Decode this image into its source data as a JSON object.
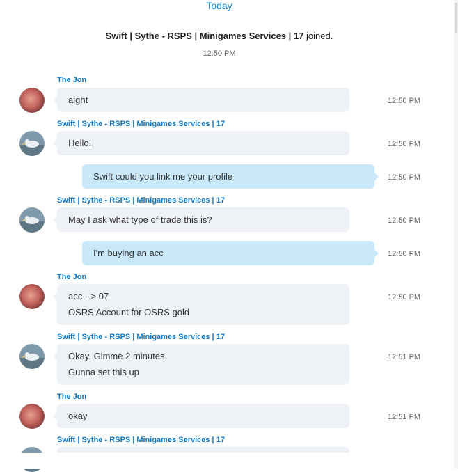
{
  "conversation": {
    "day_label": "Today",
    "join_event": {
      "name": "Swift | Sythe - RSPS | Minigames Services | 17",
      "action": "joined.",
      "time": "12:50 PM"
    },
    "messages": [
      {
        "sender": "The Jon",
        "avatar": "avatar-red-icon",
        "direction": "in",
        "lines": [
          "aight"
        ],
        "time": "12:50 PM"
      },
      {
        "sender": "Swift | Sythe - RSPS | Minigames Services | 17",
        "avatar": "avatar-pelican-icon",
        "direction": "in",
        "lines": [
          "Hello!"
        ],
        "time": "12:50 PM"
      },
      {
        "sender": "",
        "direction": "out",
        "lines": [
          "Swift could you link me your profile"
        ],
        "time": "12:50 PM"
      },
      {
        "sender": "Swift | Sythe - RSPS | Minigames Services | 17",
        "avatar": "avatar-pelican-icon",
        "direction": "in",
        "lines": [
          "May I ask what type of trade this is?"
        ],
        "time": "12:50 PM"
      },
      {
        "sender": "",
        "direction": "out",
        "lines": [
          "I'm buying an acc"
        ],
        "time": "12:50 PM"
      },
      {
        "sender": "The Jon",
        "avatar": "avatar-red-icon",
        "direction": "in",
        "lines": [
          "acc --> 07",
          "OSRS Account for OSRS gold"
        ],
        "time": "12:50 PM"
      },
      {
        "sender": "Swift | Sythe - RSPS | Minigames Services | 17",
        "avatar": "avatar-pelican-icon",
        "direction": "in",
        "lines": [
          "Okay. Gimme 2 minutes",
          "Gunna set this up"
        ],
        "time": "12:51 PM"
      },
      {
        "sender": "The Jon",
        "avatar": "avatar-red-icon",
        "direction": "in",
        "lines": [
          "okay"
        ],
        "time": "12:51 PM"
      },
      {
        "sender": "Swift | Sythe - RSPS | Minigames Services | 17",
        "avatar": "avatar-pelican-icon",
        "direction": "in",
        "lines": [],
        "time": ""
      }
    ]
  },
  "colors": {
    "accent": "#0f7ac6",
    "day_label": "#1a8bd0",
    "incoming_bubble": "#eef1f6",
    "outgoing_bubble": "#c9e8fa"
  }
}
